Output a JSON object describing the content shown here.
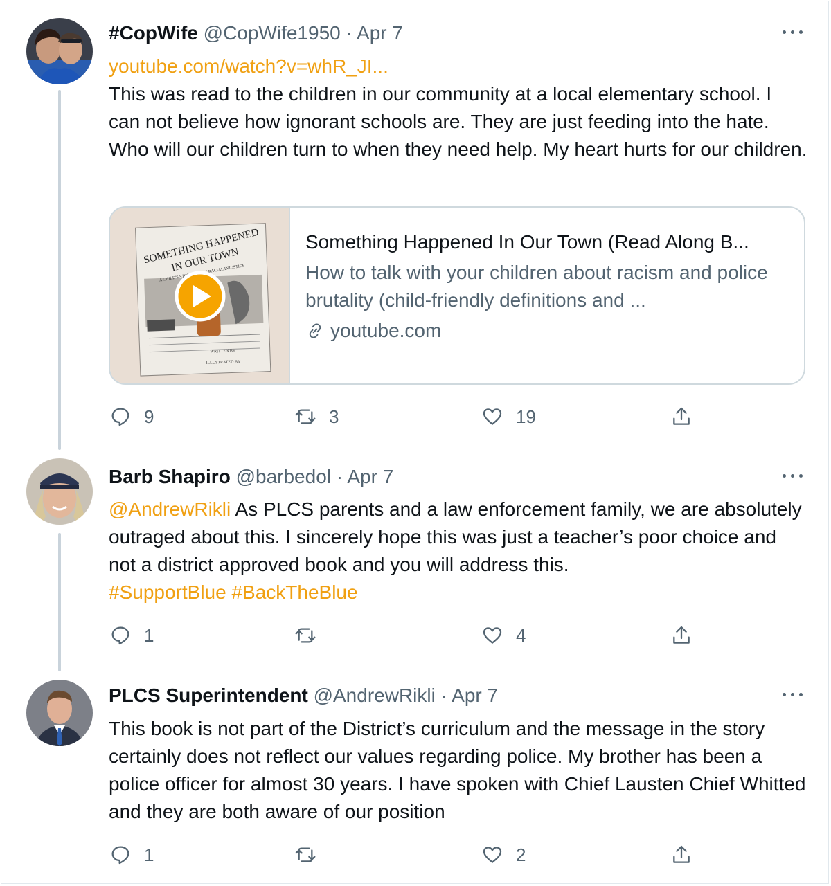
{
  "tweets": [
    {
      "name": "#CopWife",
      "handle": "@CopWife1950",
      "date": "· Apr 7",
      "link": "youtube.com/watch?v=whR_JI...",
      "text": "This was read to the children in our community at a local elementary school. I can not believe how ignorant schools are. They are just feeding into the hate. Who will our children turn to when they need help. My heart hurts for our children.",
      "card": {
        "title": "Something Happened In Our Town (Read Along B...",
        "description": "How to talk with your children about racism and police brutality (child-friendly definitions and ...",
        "domain": "youtube.com",
        "book_title_line1": "SOMETHING HAPPENED",
        "book_title_line2": "IN OUR TOWN",
        "book_subtitle": "A CHILD'S STORY ABOUT RACIAL INJUSTICE",
        "book_credit1": "WRITTEN BY",
        "book_credit2": "ILLUSTRATED BY"
      },
      "replies": "9",
      "retweets": "3",
      "likes": "19"
    },
    {
      "name": "Barb Shapiro",
      "handle": "@barbedol",
      "date": "· Apr 7",
      "mention": "@AndrewRikli",
      "text": " As PLCS parents and a law enforcement family, we are absolutely outraged about this. I sincerely hope this was just a teacher’s poor choice and not a district approved book and you will address this.",
      "hashtags": "#SupportBlue #BackTheBlue",
      "replies": "1",
      "retweets": "",
      "likes": "4"
    },
    {
      "name": "PLCS Superintendent",
      "handle": "@AndrewRikli",
      "date": "· Apr 7",
      "text": "This book is not part of the District’s curriculum and the message in the story certainly does not reflect our values regarding police. My brother has been a police officer for almost 30 years. I have spoken with Chief Lausten Chief Whitted and they are both aware of our position",
      "replies": "1",
      "retweets": "",
      "likes": "2"
    }
  ],
  "icons": {
    "reply": "reply-icon",
    "retweet": "retweet-icon",
    "like": "heart-icon",
    "share": "share-icon",
    "more": "more-icon",
    "link": "link-icon",
    "play": "play-icon"
  },
  "colors": {
    "link": "#f0a012",
    "secondary": "#536471",
    "thread_line": "#c9d3db"
  }
}
